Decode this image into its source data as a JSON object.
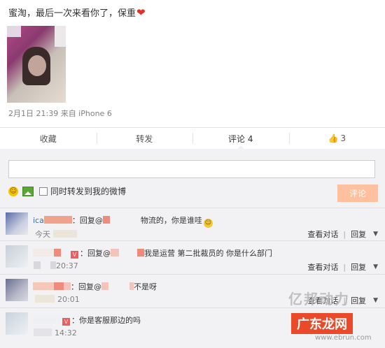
{
  "post": {
    "text": "蜜淘，最后一次来看你了，保重",
    "heart_icon": "heart-icon",
    "meta": "2月1日 21:39 来自 iPhone 6"
  },
  "actions": {
    "collect": "收藏",
    "repost": "转发",
    "comment": "评论 4",
    "like_count": "3"
  },
  "composer": {
    "input_value": "",
    "repost_label": "同时转发到我的微博",
    "submit": "评论"
  },
  "comments": [
    {
      "name": "ica",
      "reply_text": "：回复@",
      "content": "物流的，你是谁哇",
      "emoji": "emoji-face-icon",
      "time": "今天"
    },
    {
      "reply_text": "：回复@",
      "content": "我是运营 第二批裁员的 你是什么部门",
      "time": "20:37"
    },
    {
      "reply_text": "：回复@",
      "content": "不是呀",
      "time": "20:01"
    },
    {
      "reply_text": "：你是客服那边的吗",
      "content": "",
      "time": "14:32"
    }
  ],
  "comment_actions": {
    "view": "查看对话",
    "reply": "回复"
  },
  "watermark": {
    "line1": "亿邦动力",
    "line2": "广东龙网",
    "line3": "www.ebrun.com"
  },
  "colors": {
    "accent": "#ff8140",
    "submit_bg": "#ffc09f",
    "heart": "#e0302a",
    "bg_comment": "#f2f2f5"
  }
}
